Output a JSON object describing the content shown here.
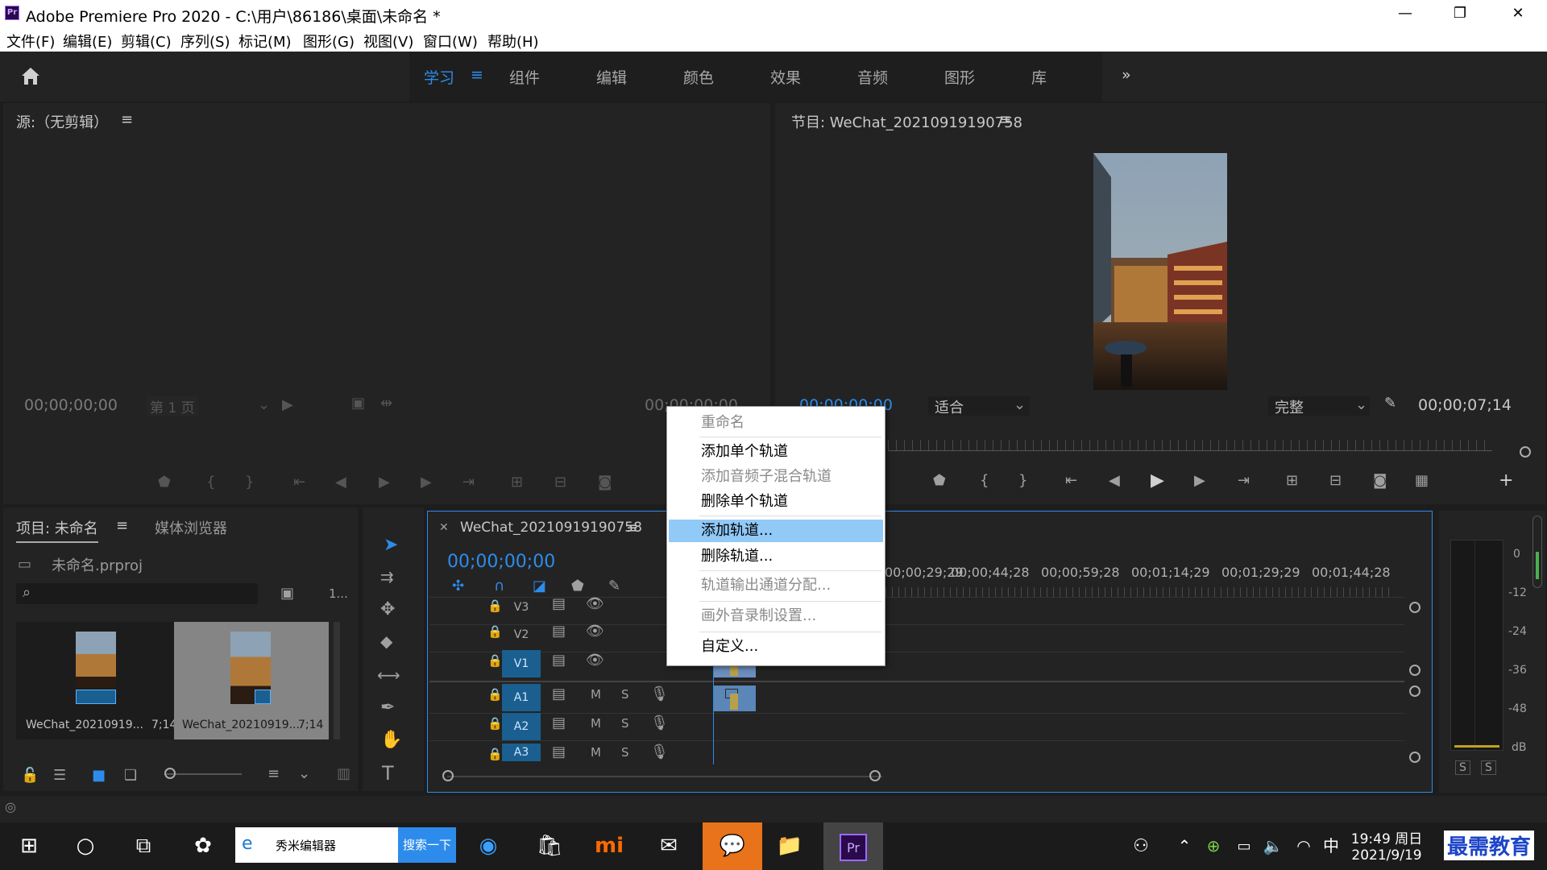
{
  "window": {
    "app_icon": "Pr",
    "title": "Adobe Premiere Pro 2020 - C:\\用户\\86186\\桌面\\未命名 *",
    "controls": [
      "minimize-icon",
      "restore-icon",
      "close-icon"
    ]
  },
  "menubar": [
    "文件(F)",
    "编辑(E)",
    "剪辑(C)",
    "序列(S)",
    "标记(M)",
    "图形(G)",
    "视图(V)",
    "窗口(W)",
    "帮助(H)"
  ],
  "workspaces": {
    "tabs": [
      "学习",
      "组件",
      "编辑",
      "颜色",
      "效果",
      "音频",
      "图形",
      "库"
    ],
    "active": "学习",
    "more": "»"
  },
  "source_panel": {
    "title": "源:（无剪辑）",
    "timecode_left": "00;00;00;00",
    "page": "第 1 页",
    "timecode_right": "00;00;00;00"
  },
  "program_panel": {
    "title": "节目: WeChat_20210919190758",
    "timecode_left": "00;00;00;00",
    "fit": "适合",
    "quality": "完整",
    "duration": "00;00;07;14"
  },
  "project_panel": {
    "tab_project": "项目: 未命名",
    "tab_media": "媒体浏览器",
    "file": "未命名.prproj",
    "count": "1...",
    "items": [
      {
        "name": "WeChat_20210919...",
        "duration": "7;14"
      },
      {
        "name": "WeChat_20210919...",
        "duration": "7;14"
      }
    ]
  },
  "timeline": {
    "tab": "WeChat_20210919190758",
    "timecode": "00;00;00;00",
    "ruler": [
      "00;00;29;29",
      "00;00;44;28",
      "00;00;59;28",
      "00;01;14;29",
      "00;01;29;29",
      "00;01;44;28"
    ],
    "video_tracks": [
      "V3",
      "V2",
      "V1"
    ],
    "audio_tracks": [
      "A1",
      "A2",
      "A3"
    ],
    "mute": "M",
    "solo": "S"
  },
  "context_menu": {
    "items": [
      {
        "label": "重命名",
        "disabled": true
      },
      {
        "label": "添加单个轨道",
        "disabled": false
      },
      {
        "label": "添加音频子混合轨道",
        "disabled": true
      },
      {
        "label": "删除单个轨道",
        "disabled": false
      },
      {
        "label": "添加轨道...",
        "disabled": false,
        "highlight": true
      },
      {
        "label": "删除轨道...",
        "disabled": false
      },
      {
        "label": "轨道输出通道分配...",
        "disabled": true
      },
      {
        "label": "画外音录制设置...",
        "disabled": true
      },
      {
        "label": "自定义...",
        "disabled": false
      }
    ]
  },
  "audio_meter": {
    "scale": [
      "0",
      "-12",
      "-24",
      "-36",
      "-48",
      "dB"
    ],
    "solo_buttons": [
      "S",
      "S"
    ]
  },
  "taskbar": {
    "search_text": "秀米编辑器",
    "search_button": "搜索一下",
    "time": "19:49 周日",
    "date": "2021/9/19",
    "ime": "中",
    "watermark": "最需教育"
  },
  "colors": {
    "accent_blue": "#2d8ceb",
    "panel_bg": "#232323",
    "menu_highlight": "#91c9f7",
    "track_selected": "#1a5f8f"
  }
}
